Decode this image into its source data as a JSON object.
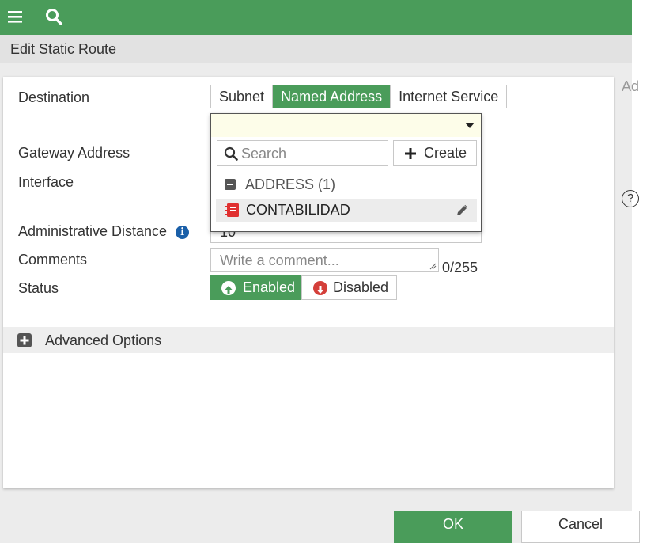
{
  "header": {
    "menu_icon": "hamburger-menu-icon",
    "search_icon": "search-icon"
  },
  "dialog": {
    "title": "Edit Static Route"
  },
  "form": {
    "destination_label": "Destination",
    "destination_types": [
      {
        "label": "Subnet",
        "active": false
      },
      {
        "label": "Named Address",
        "active": true
      },
      {
        "label": "Internet Service",
        "active": false
      }
    ],
    "gateway_label": "Gateway Address",
    "interface_label": "Interface",
    "admin_distance_label": "Administrative Distance",
    "admin_distance_value": "10",
    "comments_label": "Comments",
    "comments_placeholder": "Write a comment...",
    "comments_counter": "0/255",
    "status_label": "Status",
    "status_enabled": "Enabled",
    "status_disabled": "Disabled"
  },
  "dropdown": {
    "search_placeholder": "Search",
    "create_label": "Create",
    "group_label": "ADDRESS (1)",
    "items": [
      {
        "label": "CONTABILIDAD"
      }
    ]
  },
  "advanced": {
    "label": "Advanced Options"
  },
  "footer": {
    "ok_label": "OK",
    "cancel_label": "Cancel"
  },
  "side": {
    "cut_text": "Ad"
  },
  "colors": {
    "accent": "#4a9c5a",
    "info": "#1a5fa8",
    "disabled_red": "#d43f3a",
    "address_red": "#e03030"
  }
}
